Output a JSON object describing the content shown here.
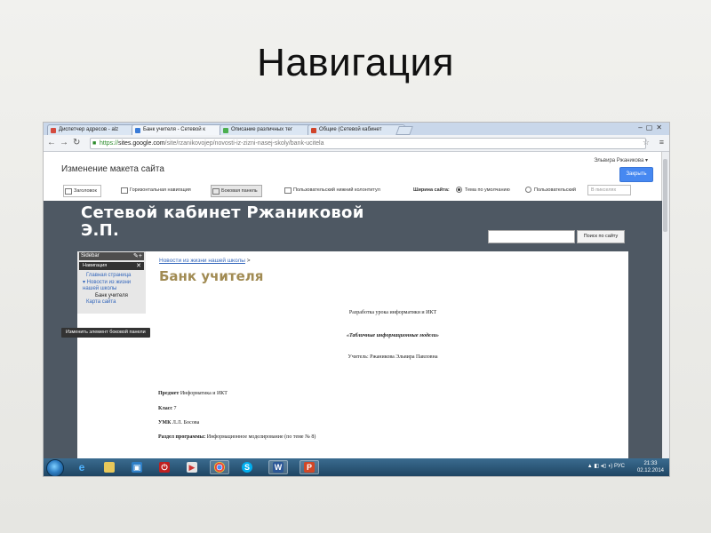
{
  "slide": {
    "title": "Навигация"
  },
  "browser": {
    "tabs": [
      {
        "label": "Диспетчер адресов - alz",
        "favicon_color": "#d44b3f"
      },
      {
        "label": "Банк учителя - Сетевой к",
        "favicon_color": "#3b7cd8"
      },
      {
        "label": "Описание различных тег",
        "favicon_color": "#4caf50"
      },
      {
        "label": "Общие (Сетевой кабинет",
        "favicon_color": "#d0442a"
      }
    ],
    "url": {
      "scheme": "https://",
      "host": "sites.google.com",
      "path": "/site/rzanikovojep/novosti-iz-zizni-nasej-skoly/bank-ucitela"
    }
  },
  "editor": {
    "title": "Изменение макета сайта",
    "user": "Эльвира Ржаникова ▾",
    "close_label": "Закрыть",
    "toolbar": {
      "header": "Заголовок",
      "horizontal_nav": "Горизонтальная навигация",
      "sidebar": "Боковая панель",
      "custom_footer": "Пользовательский нижний колонтитул",
      "width_label": "Ширина сайта:",
      "width_default": "Тема по умолчанию",
      "width_custom": "Пользовательский",
      "px_placeholder": "В пикселях"
    }
  },
  "site": {
    "title": "Сетевой кабинет Ржаниковой Э.П.",
    "search_button": "Поиск по сайту",
    "sidebar": {
      "header": "Sidebar",
      "nav_label": "Навигация",
      "items": [
        "Главная страница",
        "▾ Новости из жизни нашей школы",
        "Банк учителя",
        "Карта сайта"
      ],
      "tooltip": "Изменить элемент боковой панели"
    },
    "breadcrumb_link": "Новости из жизни нашей школы",
    "breadcrumb_sep": ">",
    "page_title": "Банк учителя",
    "doc": {
      "line1": "Разработка урока информатики и ИКТ",
      "line2": "«Табличные информационные модели»",
      "line3": "Учитель: Ржаникова Эльвира Павловна",
      "subject_label": "Предмет",
      "subject": "Информатика и ИКТ",
      "class_label": "Класс",
      "class": "7",
      "umk_label": "УМК",
      "umk": "Л.Л. Босова",
      "section_label": "Раздел программы:",
      "section": "Информационное моделирование (по теме № 8)"
    }
  },
  "taskbar": {
    "tray_text": "▲ ◧ ◂▯ ◖) РУС",
    "time": "21:33",
    "date": "02.12.2014"
  }
}
